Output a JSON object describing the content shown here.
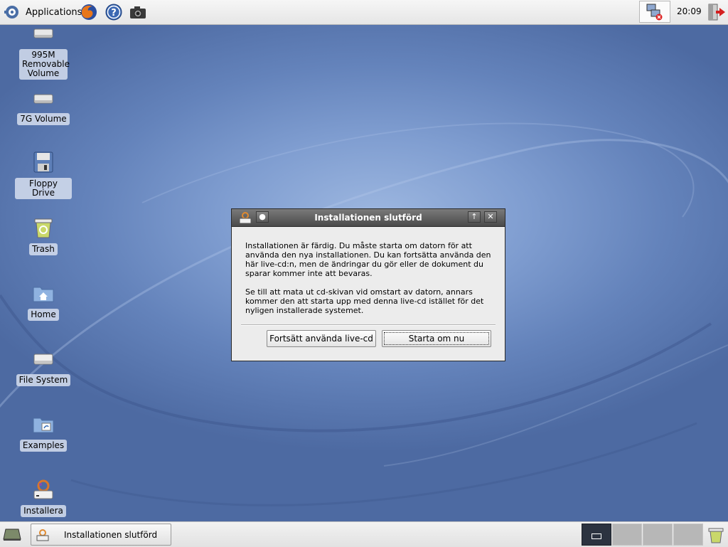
{
  "top_panel": {
    "app_menu_label": "Applications",
    "launchers": [
      "firefox-icon",
      "help-icon",
      "camera-icon"
    ],
    "clock": "20:09"
  },
  "desktop": {
    "icons": [
      {
        "label": "995M Removable Volume",
        "icon": "drive-icon"
      },
      {
        "label": "7G Volume",
        "icon": "drive-icon"
      },
      {
        "label": "Floppy Drive",
        "icon": "floppy-icon"
      },
      {
        "label": "Trash",
        "icon": "trash-icon"
      },
      {
        "label": "Home",
        "icon": "home-folder-icon"
      },
      {
        "label": "File System",
        "icon": "drive-icon"
      },
      {
        "label": "Examples",
        "icon": "folder-icon"
      },
      {
        "label": "Installera",
        "icon": "installer-icon"
      }
    ]
  },
  "dialog": {
    "title": "Installationen slutförd",
    "paragraph1": "Installationen är färdig. Du måste starta om datorn för att använda den nya installationen. Du kan fortsätta använda den här live-cd:n, men de ändringar du gör eller de dokument du sparar kommer inte att bevaras.",
    "paragraph2": "Se till att mata ut cd-skivan vid omstart av datorn, annars kommer den att starta upp med denna live-cd istället för det nyligen installerade systemet.",
    "continue_button": "Fortsätt använda live-cd",
    "restart_button": "Starta om nu"
  },
  "bottom_panel": {
    "task_label": "Installationen slutförd",
    "workspaces": 4,
    "active_workspace": 1
  }
}
